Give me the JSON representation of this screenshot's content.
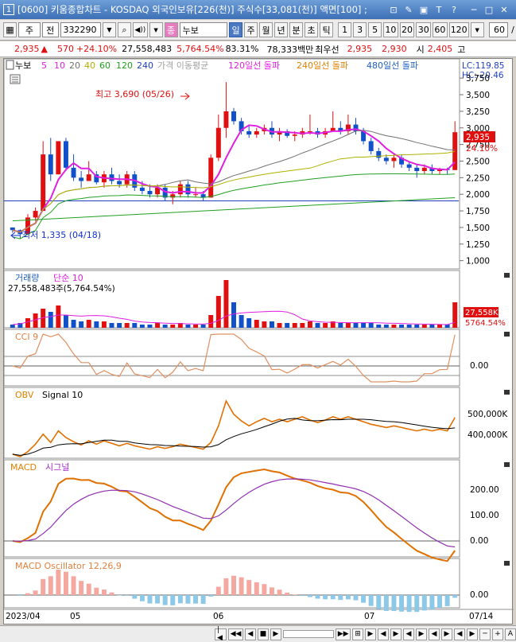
{
  "window": {
    "number": "1",
    "title": "[0600] 키움종합차트 - KOSDAQ 외국인보유[226(천)] 주식수[33,081(천)] 액면[100] ;",
    "buttons": [
      "⊡",
      "✎",
      "▣",
      "T",
      "?",
      "─",
      "□",
      "✕"
    ]
  },
  "toolbar": {
    "period_type": "주",
    "market": "전",
    "code": "332290",
    "dropdown_arrow": "▼",
    "sound_icon": "◀))",
    "sound_arrow": "▼",
    "stock_name": "누보",
    "timeframes": [
      "일",
      "주",
      "월",
      "년",
      "분",
      "초",
      "틱"
    ],
    "active_timeframe": "일",
    "minutes": [
      "1",
      "3",
      "5",
      "10",
      "20",
      "30",
      "60",
      "120"
    ],
    "count": "60",
    "more": "/"
  },
  "quote": {
    "price": "2,935",
    "arrow": "▲",
    "change": "570",
    "change_pct": "+24.10%",
    "volume": "27,558,483",
    "volume_ratio": "5,764.54%",
    "rate": "83.31%",
    "amount": "78,333백만",
    "best_label": "최우선",
    "best_ask": "2,935",
    "best_bid": "2,930",
    "open_label": "시",
    "open": "2,405",
    "high_label": "고"
  },
  "legend": {
    "name": "누보",
    "mas": [
      {
        "label": "5",
        "color": "#e020e0"
      },
      {
        "label": "10",
        "color": "#e020e0"
      },
      {
        "label": "20",
        "color": "#707070"
      },
      {
        "label": "40",
        "color": "#b0b000"
      },
      {
        "label": "60",
        "color": "#20a020"
      },
      {
        "label": "120",
        "color": "#20a020"
      },
      {
        "label": "240",
        "color": "#2040c0"
      }
    ],
    "ma_note": "가격 이동평균",
    "breakouts": [
      {
        "label": "120일선 돌파",
        "color": "#e020e0"
      },
      {
        "label": "240일선 돌파",
        "color": "#e08000"
      },
      {
        "label": "480일선 돌파",
        "color": "#2060c0"
      }
    ],
    "lc": "LC:119.85",
    "hc": "HC:-20.46"
  },
  "annotations": {
    "high": "최고 3,690 (05/26)",
    "low": "최저 1,335 (04/18)"
  },
  "price_panel": {
    "ticks": [
      "3,750",
      "3,500",
      "3,250",
      "3,000",
      "2,750",
      "2,500",
      "2,250",
      "2,000",
      "1,750",
      "1,500",
      "1,250",
      "1,000"
    ],
    "last_price": "2,935",
    "last_pct": "24.10%"
  },
  "volume_panel": {
    "title": "거래량",
    "ma_label": "단순 10",
    "value_line": "27,558,483주(5,764.54%)",
    "last_value": "27,558K",
    "last_pct": "5764.54%"
  },
  "cci_panel": {
    "title": "CCI 9",
    "tick": "0.00"
  },
  "obv_panel": {
    "title": "OBV",
    "signal": "Signal 10",
    "ticks": [
      "500,000K",
      "400,000K"
    ]
  },
  "macd_panel": {
    "title": "MACD",
    "signal": "시그널",
    "ticks": [
      "200.00",
      "100.00",
      "0.00"
    ]
  },
  "osc_panel": {
    "title": "MACD Oscillator 12,26,9",
    "tick": "0.00"
  },
  "x_axis": {
    "labels": [
      "2023/04",
      "05",
      "06",
      "07"
    ],
    "right_label": "07/14"
  },
  "statusbar": {
    "buttons": [
      "|◀",
      "◀◀",
      "◀",
      "■",
      "▶",
      "▶▶",
      "⊞",
      "▶",
      "◀",
      "▶",
      "◀",
      "▶",
      "◀",
      "▶",
      "◀",
      "▶",
      "─",
      "+",
      "A"
    ]
  },
  "chart_data": {
    "type": "candlestick",
    "dates_first": "2023/04",
    "last_date": "07/14",
    "high_marker": {
      "date": "05/26",
      "price": 3690
    },
    "low_marker": {
      "date": "04/18",
      "price": 1335
    },
    "ylim": [
      900,
      3800
    ],
    "candles": [
      [
        1500,
        1500,
        1420,
        1460
      ],
      [
        1460,
        1470,
        1335,
        1400
      ],
      [
        1400,
        1700,
        1400,
        1650
      ],
      [
        1650,
        1800,
        1600,
        1750
      ],
      [
        1750,
        2800,
        1750,
        2600
      ],
      [
        2600,
        2850,
        2200,
        2300
      ],
      [
        2300,
        2800,
        2300,
        2800
      ],
      [
        2800,
        2850,
        2350,
        2400
      ],
      [
        2400,
        2600,
        2200,
        2250
      ],
      [
        2250,
        2350,
        2100,
        2200
      ],
      [
        2200,
        2500,
        2200,
        2300
      ],
      [
        2300,
        2350,
        2150,
        2180
      ],
      [
        2180,
        2350,
        2100,
        2300
      ],
      [
        2300,
        2400,
        2150,
        2200
      ],
      [
        2200,
        2300,
        2100,
        2150
      ],
      [
        2150,
        2350,
        2100,
        2300
      ],
      [
        2300,
        2350,
        2050,
        2100
      ],
      [
        2100,
        2200,
        2000,
        2050
      ],
      [
        2050,
        2150,
        1950,
        2000
      ],
      [
        2000,
        2150,
        1950,
        2100
      ],
      [
        2100,
        2150,
        1900,
        1950
      ],
      [
        1950,
        2050,
        1850,
        2000
      ],
      [
        2000,
        2200,
        1950,
        2150
      ],
      [
        2150,
        2200,
        1950,
        2000
      ],
      [
        2000,
        2100,
        1950,
        2000
      ],
      [
        2000,
        2050,
        1900,
        1950
      ],
      [
        1950,
        2600,
        1950,
        2550
      ],
      [
        2550,
        3200,
        2500,
        3000
      ],
      [
        3000,
        3690,
        2850,
        3250
      ],
      [
        3250,
        3300,
        3050,
        3100
      ],
      [
        3100,
        3150,
        2900,
        2950
      ],
      [
        2950,
        3050,
        2850,
        2900
      ],
      [
        2900,
        3000,
        2850,
        2950
      ],
      [
        2950,
        3050,
        2900,
        3000
      ],
      [
        3000,
        3100,
        2850,
        2900
      ],
      [
        2900,
        3000,
        2800,
        2950
      ],
      [
        2950,
        2980,
        2850,
        2880
      ],
      [
        2880,
        2950,
        2800,
        2900
      ],
      [
        2900,
        3000,
        2850,
        2950
      ],
      [
        2950,
        3200,
        2900,
        2950
      ],
      [
        2950,
        3000,
        2850,
        2900
      ],
      [
        2900,
        3000,
        2850,
        2950
      ],
      [
        2950,
        3250,
        2950,
        3000
      ],
      [
        3000,
        3100,
        2900,
        2950
      ],
      [
        2950,
        3200,
        2900,
        3050
      ],
      [
        3050,
        3150,
        2900,
        2950
      ],
      [
        2950,
        3000,
        2750,
        2800
      ],
      [
        2800,
        2850,
        2600,
        2650
      ],
      [
        2650,
        2700,
        2500,
        2550
      ],
      [
        2550,
        2600,
        2450,
        2500
      ],
      [
        2500,
        2600,
        2400,
        2550
      ],
      [
        2550,
        2600,
        2400,
        2450
      ],
      [
        2450,
        2500,
        2350,
        2400
      ],
      [
        2400,
        2450,
        2250,
        2350
      ],
      [
        2350,
        2450,
        2300,
        2400
      ],
      [
        2400,
        2450,
        2300,
        2350
      ],
      [
        2350,
        2400,
        2300,
        2380
      ],
      [
        2380,
        2400,
        2300,
        2365
      ],
      [
        2365,
        3100,
        2365,
        2935
      ]
    ],
    "volume_rel": [
      2,
      3,
      6,
      9,
      12,
      10,
      14,
      8,
      5,
      4,
      5,
      4,
      4,
      3,
      3,
      3,
      3,
      2,
      2,
      3,
      2,
      2,
      3,
      2,
      2,
      2,
      8,
      20,
      30,
      16,
      8,
      6,
      5,
      4,
      4,
      3,
      3,
      3,
      3,
      4,
      3,
      3,
      4,
      3,
      3,
      3,
      3,
      3,
      2,
      2,
      2,
      2,
      2,
      2,
      2,
      2,
      2,
      2,
      16
    ]
  }
}
